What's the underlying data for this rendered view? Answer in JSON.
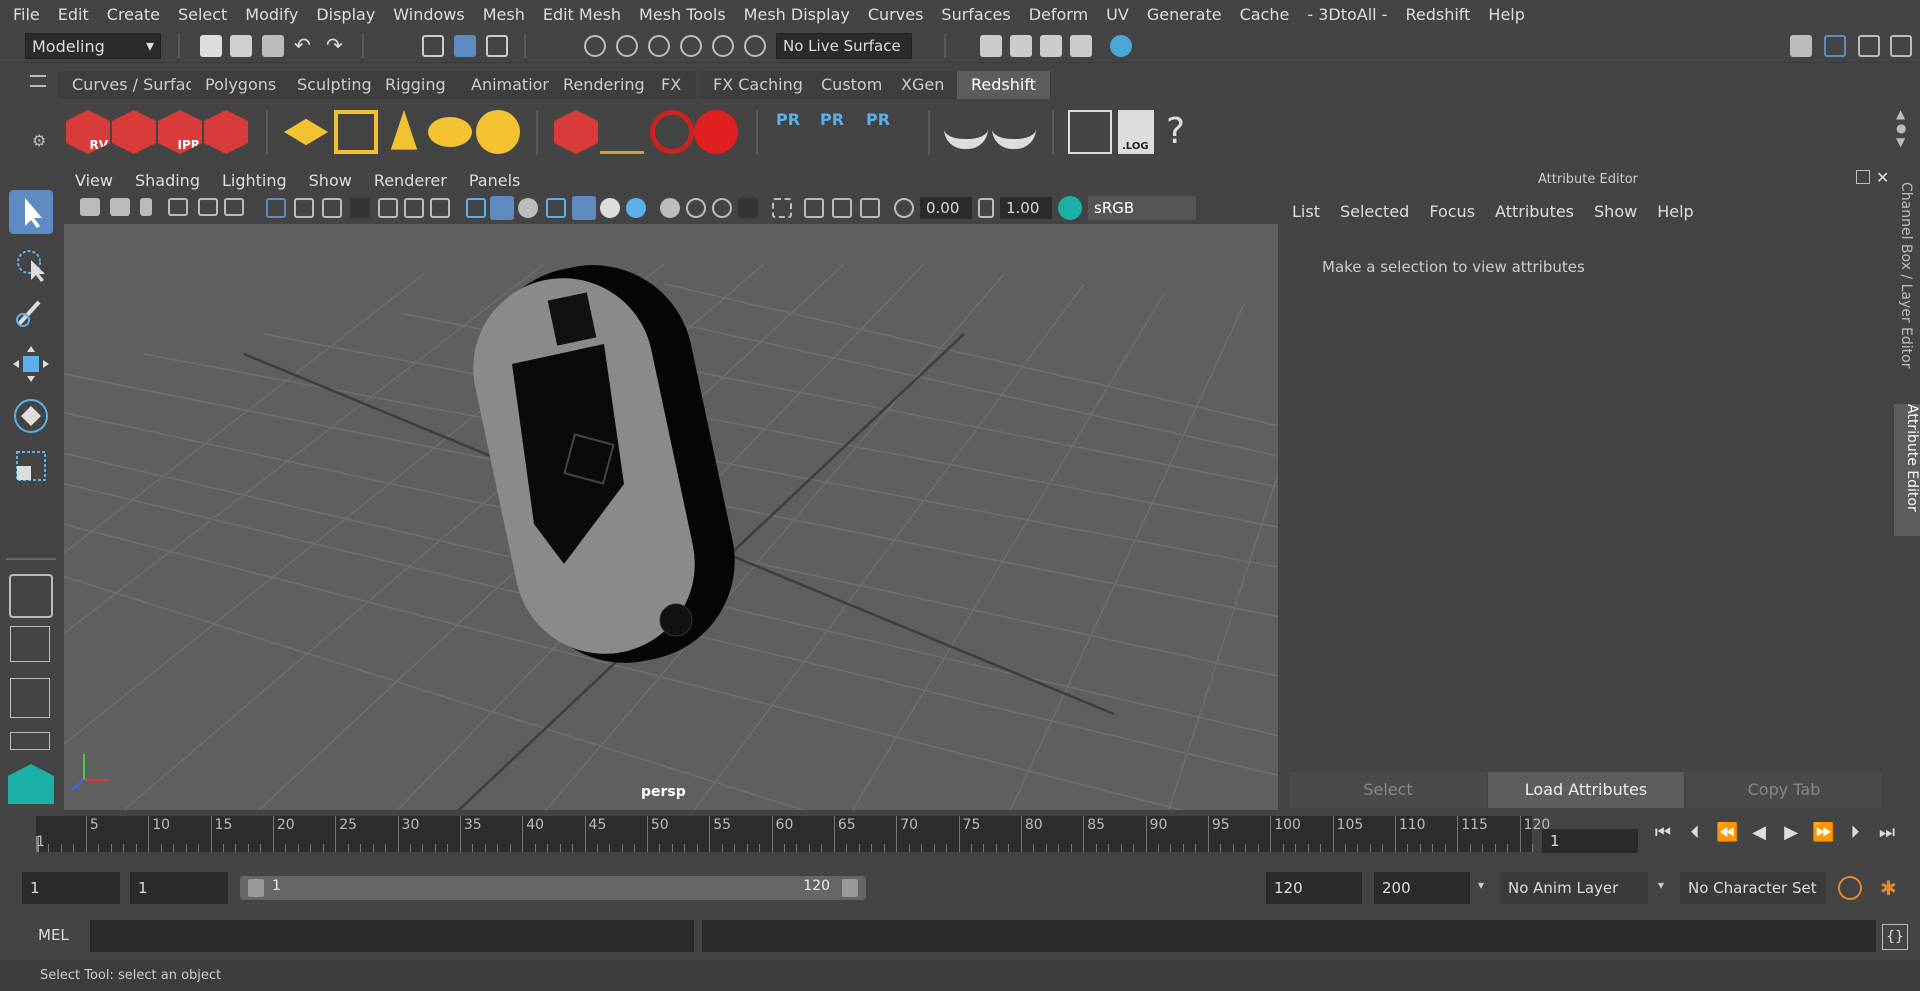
{
  "menubar": {
    "items": [
      "File",
      "Edit",
      "Create",
      "Select",
      "Modify",
      "Display",
      "Windows",
      "Mesh",
      "Edit Mesh",
      "Mesh Tools",
      "Mesh Display",
      "Curves",
      "Surfaces",
      "Deform",
      "UV",
      "Generate",
      "Cache",
      "- 3DtoAll -",
      "Redshift",
      "Help"
    ]
  },
  "status_line": {
    "mode": "Modeling",
    "live_surface": "No Live Surface"
  },
  "shelf": {
    "tabs": [
      "Curves / Surfaces",
      "Polygons",
      "Sculpting",
      "Rigging",
      "Animation",
      "Rendering",
      "FX",
      "FX Caching",
      "Custom",
      "XGen",
      "Redshift"
    ],
    "active_tab": "Redshift",
    "icon_labels": {
      "rv": "RV",
      "ipr": "IPR",
      "pr": "PR",
      "log": ".LOG",
      "help": "?"
    }
  },
  "viewport": {
    "menu": [
      "View",
      "Shading",
      "Lighting",
      "Show",
      "Renderer",
      "Panels"
    ],
    "field_a": "0.00",
    "field_b": "1.00",
    "color_space": "sRGB gamma",
    "camera_label": "persp"
  },
  "attribute_editor": {
    "title": "Attribute Editor",
    "menu": [
      "List",
      "Selected",
      "Focus",
      "Attributes",
      "Show",
      "Help"
    ],
    "message": "Make a selection to view attributes",
    "buttons": {
      "select": "Select",
      "load": "Load Attributes",
      "copy": "Copy Tab"
    }
  },
  "side_tabs": {
    "channel_box": "Channel Box / Layer Editor",
    "attribute_editor": "Attribute Editor"
  },
  "timeline": {
    "ticks": [
      5,
      10,
      15,
      20,
      25,
      30,
      35,
      40,
      45,
      50,
      55,
      60,
      65,
      70,
      75,
      80,
      85,
      90,
      95,
      100,
      105,
      110,
      115,
      120
    ],
    "start_label": "1",
    "current_frame": "1"
  },
  "range": {
    "start": "1",
    "playback_start": "1",
    "slider_start": "1",
    "slider_end": "120",
    "playback_end": "120",
    "end": "200",
    "anim_layer": "No Anim Layer",
    "character_set": "No Character Set"
  },
  "command_line": {
    "label": "MEL"
  },
  "help_line": {
    "text": "Select Tool: select an object"
  },
  "colors": {
    "accent": "#5d8bc2",
    "redshift_red": "#d93a3a",
    "yellow": "#f2c230",
    "pr_blue": "#5ab0e8"
  }
}
